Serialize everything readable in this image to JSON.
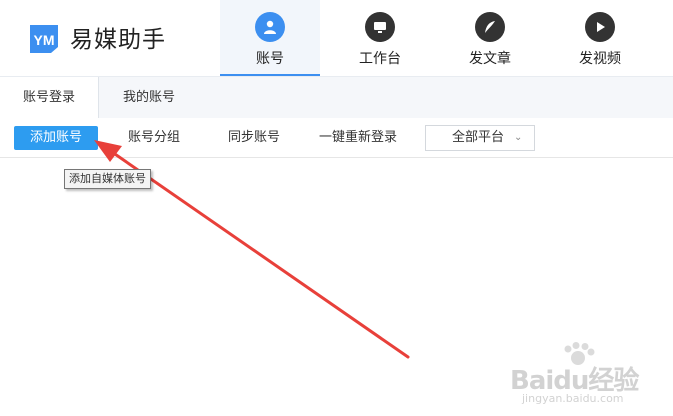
{
  "app": {
    "title": "易媒助手",
    "brand_color": "#3c8ff0",
    "logo_letters": "YM"
  },
  "nav": {
    "tabs": [
      {
        "label": "账号",
        "icon": "user-icon",
        "active": true
      },
      {
        "label": "工作台",
        "icon": "monitor-icon",
        "active": false
      },
      {
        "label": "发文章",
        "icon": "feather-icon",
        "active": false
      },
      {
        "label": "发视频",
        "icon": "play-icon",
        "active": false
      }
    ]
  },
  "subtabs": [
    {
      "label": "账号登录",
      "active": true
    },
    {
      "label": "我的账号",
      "active": false
    }
  ],
  "toolbar": {
    "add_account": "添加账号",
    "account_group": "账号分组",
    "sync_account": "同步账号",
    "relogin_all": "一键重新登录",
    "platform_select": "全部平台"
  },
  "tooltip": {
    "text": "添加自媒体账号"
  },
  "watermark": {
    "text": "Baidu经验",
    "url": "jingyan.baidu.com"
  },
  "colors": {
    "primary_button": "#2d9cf0",
    "annotation_arrow": "#e8403a"
  }
}
